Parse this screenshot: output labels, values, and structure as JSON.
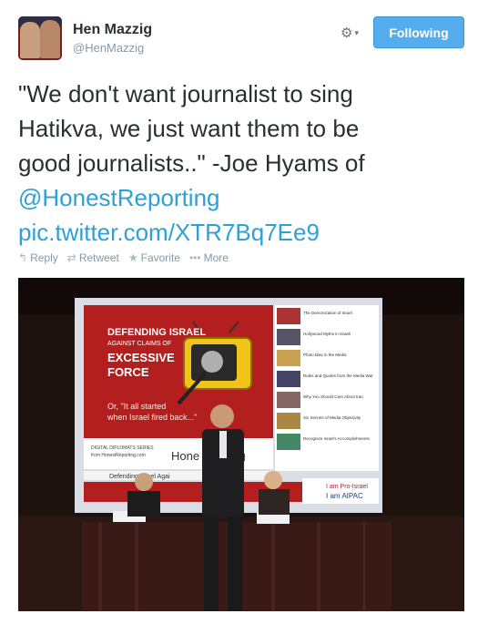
{
  "user": {
    "name": "Hen Mazzig",
    "handle": "@HenMazzig"
  },
  "follow_button": {
    "label": "Following"
  },
  "tweet": {
    "text_line1": "\"We don't want journalist to sing",
    "text_line2": "Hatikva, we just want them to be",
    "text_line3": "good journalists..\" -Joe Hyams of",
    "mention": "@HonestReporting",
    "link": "pic.twitter.com/XTR7Bq7Ee9"
  },
  "actions": [
    {
      "label": "Reply",
      "icon": "reply-icon"
    },
    {
      "label": "Retweet",
      "icon": "retweet-icon"
    },
    {
      "label": "Favorite",
      "icon": "star-icon"
    },
    {
      "label": "More",
      "icon": "more-dots-icon"
    }
  ],
  "photo": {
    "slide": {
      "line1": "DEFENDING ISRAEL",
      "line2": "AGAINST CLAIMS OF",
      "line3": "EXCESSIVE",
      "line4": "FORCE",
      "quote1": "Or, \"It all started",
      "quote2": "when Israel fired back...\"",
      "series": "DIGITAL DIPLOMATS SERIES",
      "site": "from HonestReporting.com",
      "logo": "Hone    eporting",
      "caption": "Defending Israel Agai",
      "aipac1": "I am Pro-Israel",
      "aipac2": "I am AIPAC"
    },
    "sidebar": [
      "The Demonization of Israel",
      "Hollywood Myths in Israeli",
      "Photo Bias in the Media",
      "Rules and Quotes from the Media War",
      "Why You Should Care About Iran",
      "Six Secrets of Media Objectivity",
      "Recognize Israel's Accomplishments"
    ]
  },
  "colors": {
    "accent": "#55acee",
    "link": "#2ea0d9",
    "muted": "#8899a6",
    "slide_red": "#b31f1f"
  }
}
